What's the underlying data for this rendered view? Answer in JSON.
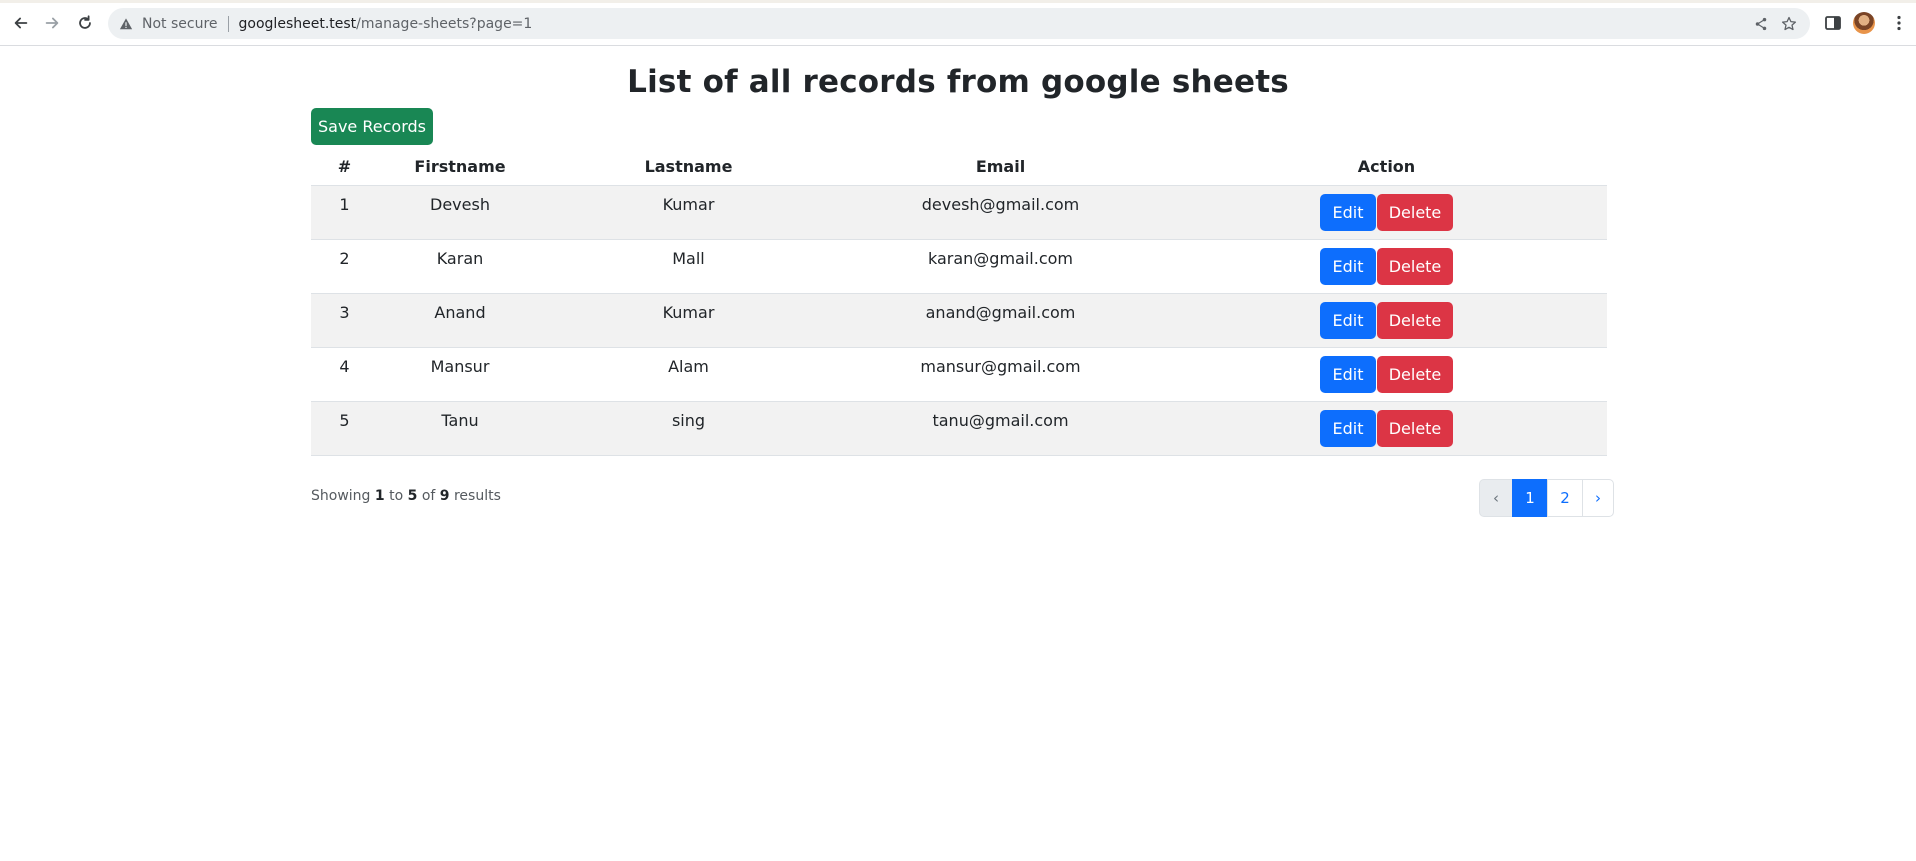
{
  "browser": {
    "security_label": "Not secure",
    "url_host": "googlesheet.test",
    "url_path": "/manage-sheets?page=1"
  },
  "page": {
    "title": "List of all records from google sheets",
    "save_button": "Save Records"
  },
  "table": {
    "headers": [
      "#",
      "Firstname",
      "Lastname",
      "Email",
      "Action"
    ],
    "rows": [
      {
        "num": "1",
        "first": "Devesh",
        "last": "Kumar",
        "email": "devesh@gmail.com"
      },
      {
        "num": "2",
        "first": "Karan",
        "last": "Mall",
        "email": "karan@gmail.com"
      },
      {
        "num": "3",
        "first": "Anand",
        "last": "Kumar",
        "email": "anand@gmail.com"
      },
      {
        "num": "4",
        "first": "Mansur",
        "last": "Alam",
        "email": "mansur@gmail.com"
      },
      {
        "num": "5",
        "first": "Tanu",
        "last": "sing",
        "email": "tanu@gmail.com"
      }
    ],
    "edit_label": "Edit",
    "delete_label": "Delete"
  },
  "summary": {
    "showing": "Showing",
    "from": "1",
    "to_word": "to",
    "to": "5",
    "of_word": "of",
    "total": "9",
    "results_word": "results"
  },
  "pagination": {
    "prev": "‹",
    "pages": [
      "1",
      "2"
    ],
    "current": "1",
    "next": "›"
  },
  "colors": {
    "success": "#198754",
    "primary": "#0d6efd",
    "danger": "#dc3545",
    "stripe": "#f2f2f2"
  }
}
